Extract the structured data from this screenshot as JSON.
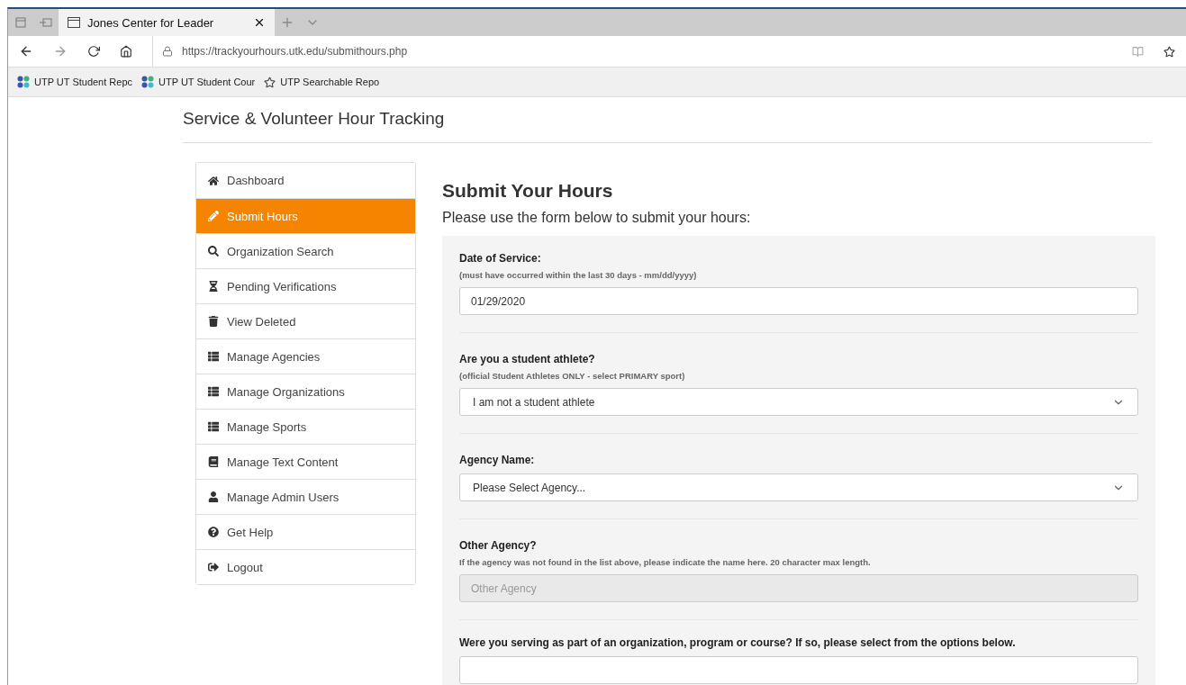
{
  "browser": {
    "tabs": [
      {
        "title": "Jones Center for Leader",
        "selected": true
      }
    ],
    "url": "https://trackyourhours.utk.edu/submithours.php",
    "bookmarks": [
      {
        "label": "UTP UT Student Repc",
        "kind": "apps"
      },
      {
        "label": "UTP UT Student Cour",
        "kind": "apps"
      },
      {
        "label": "UTP Searchable Repo",
        "kind": "star"
      }
    ]
  },
  "site_title": "Service & Volunteer Hour Tracking",
  "sidebar": {
    "items": [
      {
        "label": "Dashboard",
        "selected": false
      },
      {
        "label": "Submit Hours",
        "selected": true
      },
      {
        "label": "Organization Search",
        "selected": false
      },
      {
        "label": "Pending Verifications",
        "selected": false
      },
      {
        "label": "View Deleted",
        "selected": false
      },
      {
        "label": "Manage Agencies",
        "selected": false
      },
      {
        "label": "Manage Organizations",
        "selected": false
      },
      {
        "label": "Manage Sports",
        "selected": false
      },
      {
        "label": "Manage Text Content",
        "selected": false
      },
      {
        "label": "Manage Admin Users",
        "selected": false
      },
      {
        "label": "Get Help",
        "selected": false
      },
      {
        "label": "Logout",
        "selected": false
      }
    ]
  },
  "form": {
    "title": "Submit Your Hours",
    "subtitle": "Please use the form below to submit your hours:",
    "fields": [
      {
        "kind": "text",
        "label": "Date of Service:",
        "hint": "(must have occurred within the last 30 days - mm/dd/yyyy)",
        "value": "01/29/2020",
        "disabled": false
      },
      {
        "kind": "select",
        "label": "Are you a student athlete?",
        "hint": "(official Student Athletes ONLY - select PRIMARY sport)",
        "value": "I am not a student athlete"
      },
      {
        "kind": "select",
        "label": "Agency Name:",
        "value": "Please Select Agency..."
      },
      {
        "kind": "text",
        "label": "Other Agency?",
        "hint": "If the agency was not found in the list above, please indicate the name here. 20 character max length.",
        "placeholder": "Other Agency",
        "disabled": true
      },
      {
        "kind": "select",
        "label": "Were you serving as part of an organization, program or course? If so, please select from the options below."
      }
    ]
  }
}
